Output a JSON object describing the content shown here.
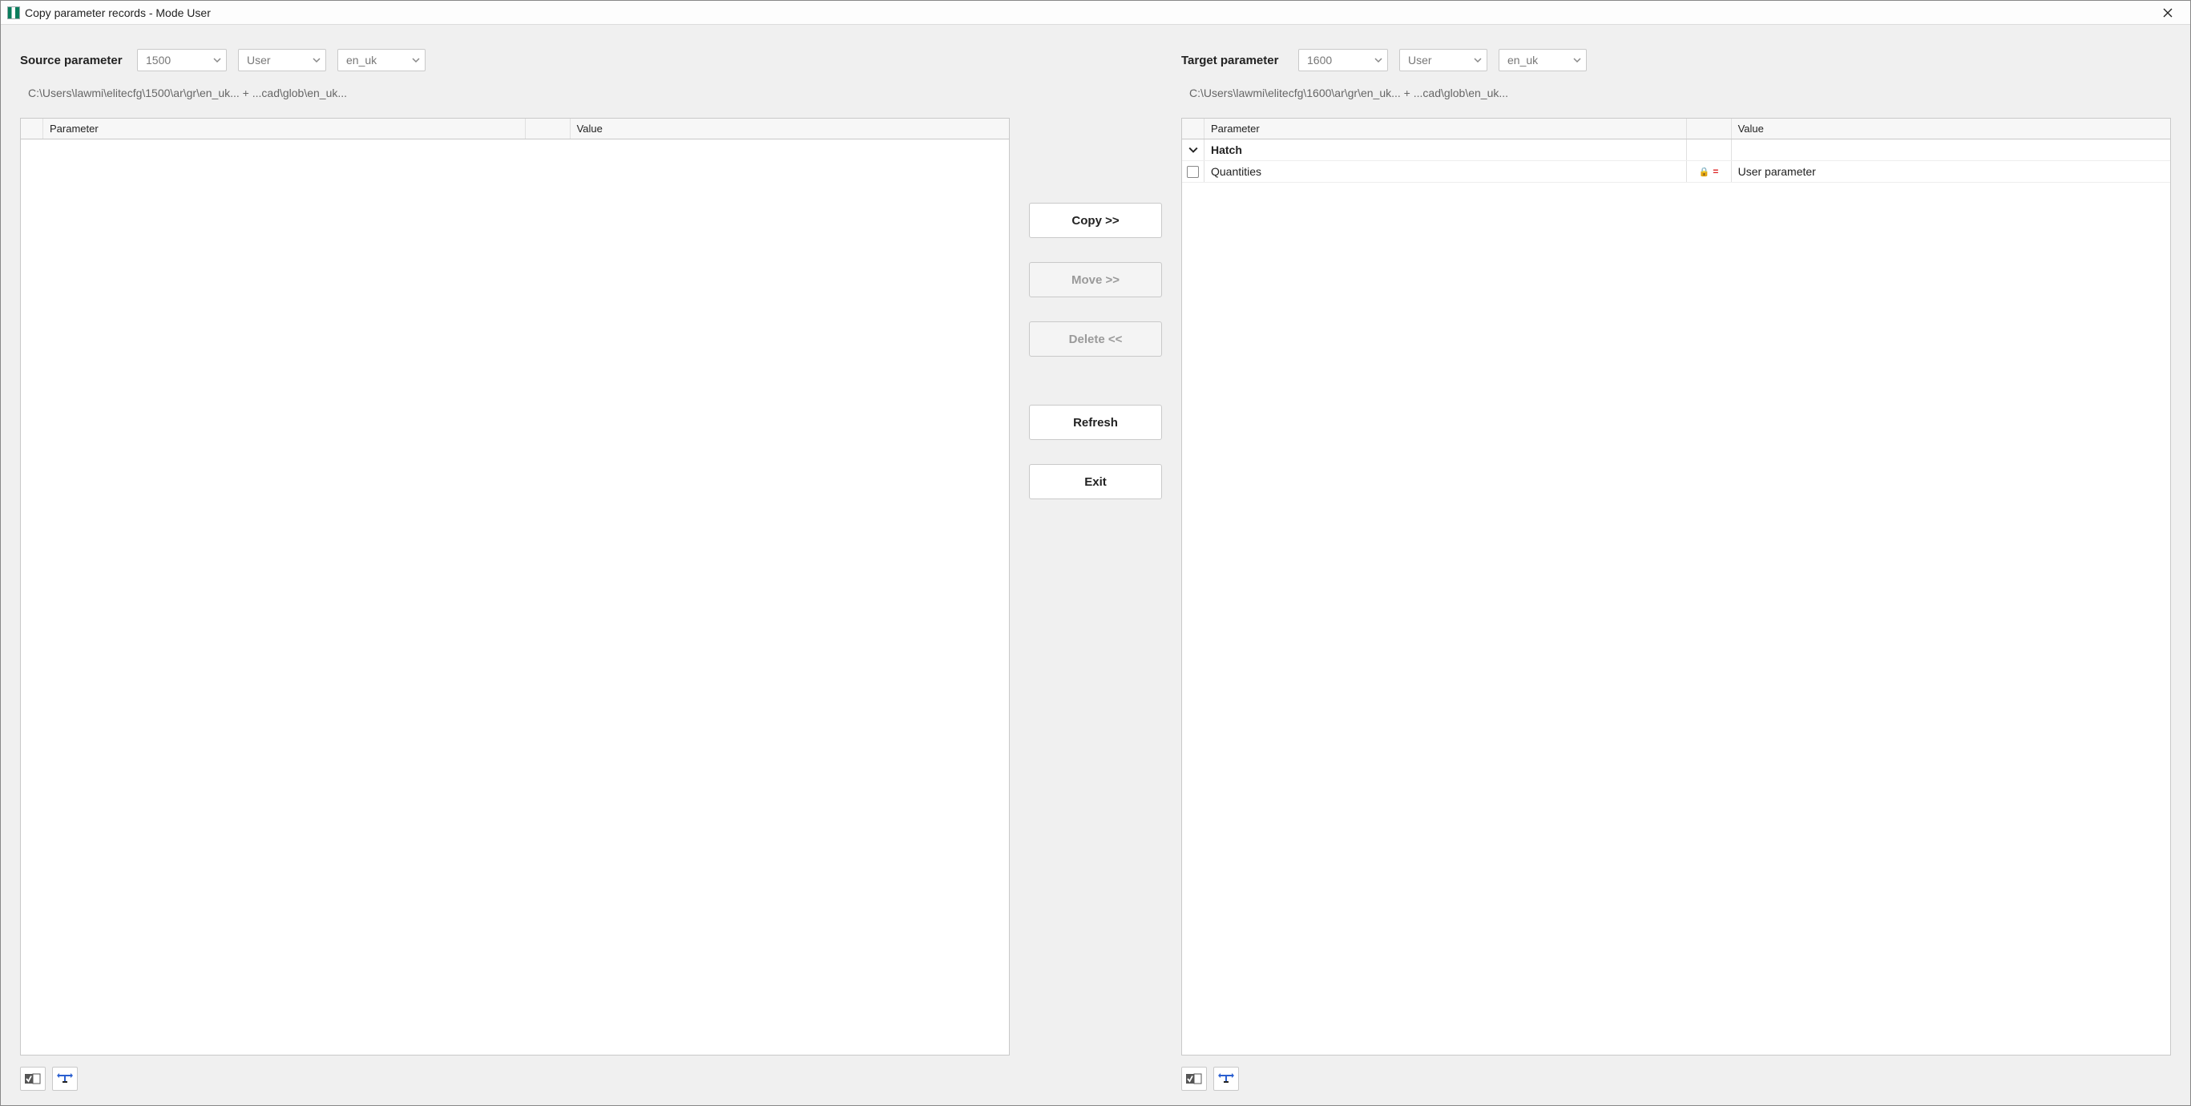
{
  "window": {
    "title": "Copy parameter records - Mode User"
  },
  "source": {
    "label": "Source parameter",
    "version": "1500",
    "role": "User",
    "lang": "en_uk",
    "path": "C:\\Users\\lawmi\\elitecfg\\1500\\ar\\gr\\en_uk...  +  ...cad\\glob\\en_uk...",
    "columns": {
      "param": "Parameter",
      "value": "Value"
    },
    "rows": []
  },
  "target": {
    "label": "Target parameter",
    "version": "1600",
    "role": "User",
    "lang": "en_uk",
    "path": "C:\\Users\\lawmi\\elitecfg\\1600\\ar\\gr\\en_uk...  +  ...cad\\glob\\en_uk...",
    "columns": {
      "param": "Parameter",
      "value": "Value"
    },
    "rows": [
      {
        "type": "group",
        "param": "Hatch",
        "value": ""
      },
      {
        "type": "item",
        "param": "Quantities",
        "value": "User parameter",
        "locked": true
      }
    ]
  },
  "buttons": {
    "copy": "Copy >>",
    "move": "Move >>",
    "delete": "Delete <<",
    "refresh": "Refresh",
    "exit": "Exit"
  }
}
